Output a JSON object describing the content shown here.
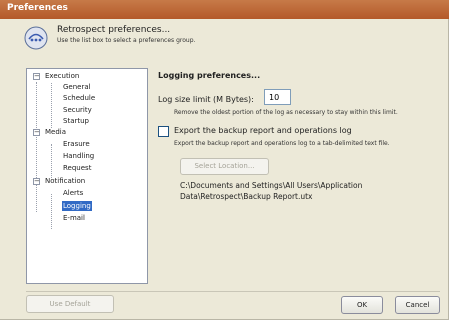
{
  "window": {
    "title": "Preferences"
  },
  "header": {
    "title": "Retrospect preferences...",
    "subtitle": "Use the list box to select a preferences group."
  },
  "tree": {
    "groups": [
      {
        "label": "Execution",
        "expanded": true,
        "items": [
          "General",
          "Schedule",
          "Security",
          "Startup"
        ]
      },
      {
        "label": "Media",
        "expanded": true,
        "items": [
          "Erasure",
          "Handling",
          "Request"
        ]
      },
      {
        "label": "Notification",
        "expanded": true,
        "items": [
          "Alerts",
          "Logging",
          "E-mail"
        ]
      }
    ],
    "selected": "Logging"
  },
  "panel": {
    "title": "Logging preferences...",
    "log_size_label": "Log size limit (M Bytes):",
    "log_size_value": "10",
    "log_size_note": "Remove the oldest portion of the log as necessary to stay within this limit.",
    "export_label": "Export the backup report and operations log",
    "export_checked": false,
    "export_note": "Export the backup report and operations log to a tab-delimited text file.",
    "select_location_label": "Select Location...",
    "path_line1": "C:\\Documents and Settings\\All Users\\Application",
    "path_line2": "Data\\Retrospect\\Backup Report.utx"
  },
  "footer": {
    "use_default_label": "Use Default",
    "ok_label": "OK",
    "cancel_label": "Cancel"
  },
  "colors": {
    "titlebar": "#b4592a",
    "dialog_bg": "#ece9d8",
    "selection": "#316ac5"
  }
}
